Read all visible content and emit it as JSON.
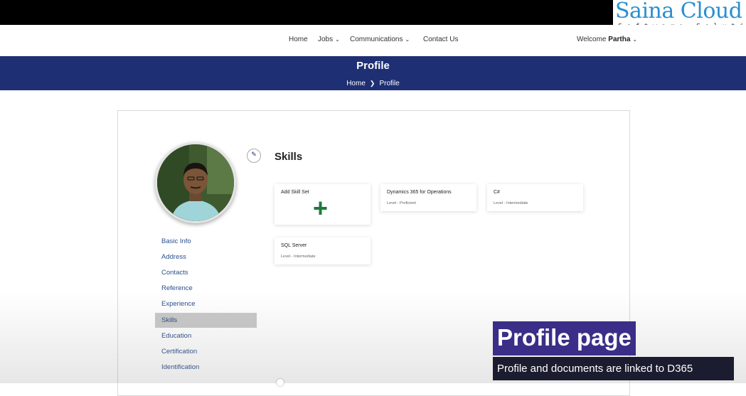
{
  "logo": {
    "main": "Saina Cloud",
    "sub": "Software Solutions"
  },
  "nav": {
    "home": "Home",
    "jobs": "Jobs",
    "communications": "Communications",
    "contact": "Contact Us",
    "welcome_prefix": "Welcome",
    "user": "Partha"
  },
  "banner": {
    "title": "Profile",
    "crumb_home": "Home",
    "crumb_current": "Profile"
  },
  "sidebar": {
    "items": [
      {
        "label": "Basic Info"
      },
      {
        "label": "Address"
      },
      {
        "label": "Contacts"
      },
      {
        "label": "Reference"
      },
      {
        "label": "Experience"
      },
      {
        "label": "Skills"
      },
      {
        "label": "Education"
      },
      {
        "label": "Certification"
      },
      {
        "label": "Identification"
      }
    ],
    "active": "Skills"
  },
  "skills": {
    "title": "Skills",
    "add_label": "Add Skill Set",
    "cards": [
      {
        "name": "Dynamics 365 for Operations",
        "level": "Level - Proficient"
      },
      {
        "name": "C#",
        "level": "Level - Intermediate"
      },
      {
        "name": "SQL Server",
        "level": "Level - Intermediate"
      }
    ]
  },
  "caption": {
    "title": "Profile page",
    "subtitle": "Profile and documents are linked to D365"
  },
  "colors": {
    "banner": "#1e2f73",
    "caption_title_bg": "#3a2e88",
    "plus": "#1e7a3c",
    "link": "#2b4f8c"
  }
}
